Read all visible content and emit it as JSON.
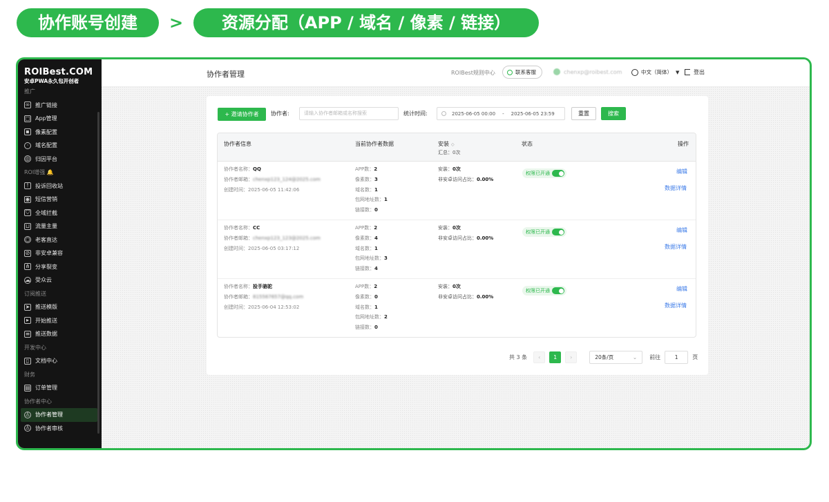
{
  "banner": {
    "step1": "协作账号创建",
    "arrow": ">",
    "step2": "资源分配（APP / 域名 / 像素 / 链接）"
  },
  "sidebar": {
    "logo_title": "ROIBest.COM",
    "logo_sub": "安卓PWA永久包开创者",
    "sections": [
      {
        "title": "推广",
        "items": [
          {
            "label": "推广链接",
            "icon": "link-icon"
          },
          {
            "label": "App管理",
            "icon": "app-icon"
          },
          {
            "label": "像素配置",
            "icon": "pixel-icon"
          },
          {
            "label": "域名配置",
            "icon": "globe-icon"
          },
          {
            "label": "归因平台",
            "icon": "attribution-icon"
          }
        ]
      },
      {
        "title": "ROI增强 🔔",
        "items": [
          {
            "label": "投诉回收站",
            "icon": "complaint-icon"
          },
          {
            "label": "短信营销",
            "icon": "sms-icon"
          },
          {
            "label": "全域拦截",
            "icon": "shield-icon"
          },
          {
            "label": "流量主量",
            "icon": "traffic-icon"
          },
          {
            "label": "老客直达",
            "icon": "customer-icon"
          },
          {
            "label": "非安卓兼容",
            "icon": "android-off-icon"
          },
          {
            "label": "分享裂变",
            "icon": "share-icon"
          },
          {
            "label": "受众云",
            "icon": "cloud-icon"
          }
        ]
      },
      {
        "title": "订阅推送",
        "items": [
          {
            "label": "推送模版",
            "icon": "send-icon"
          },
          {
            "label": "开始推送",
            "icon": "push-icon"
          },
          {
            "label": "推送数据",
            "icon": "data-icon"
          }
        ]
      },
      {
        "title": "开发中心",
        "items": [
          {
            "label": "文档中心",
            "icon": "doc-icon"
          }
        ]
      },
      {
        "title": "财务",
        "items": [
          {
            "label": "订单管理",
            "icon": "order-icon"
          }
        ]
      },
      {
        "title": "协作者中心",
        "items": [
          {
            "label": "协作者管理",
            "icon": "user-manage-icon",
            "active": true
          },
          {
            "label": "协作者审核",
            "icon": "user-review-icon"
          }
        ]
      }
    ]
  },
  "header": {
    "title": "协作者管理",
    "help": "ROIBest规则中心",
    "customer_service": "联系客服",
    "user_email": "chenxp@roibest.com",
    "language": "中文（简体）",
    "logout": "登出"
  },
  "filters": {
    "invite_button": "+ 邀请协作者",
    "collaborator_label": "协作者:",
    "collaborator_placeholder": "请输入协作者邮箱或名称搜索",
    "time_label": "统计时间:",
    "time_start": "2025-06-05 00:00",
    "time_sep": "-",
    "time_end": "2025-06-05 23:59",
    "reset": "重置",
    "search": "搜索"
  },
  "table": {
    "headers": {
      "info": "协作者信息",
      "data": "当前协作者数据",
      "install": "安装",
      "install_sort": "◇",
      "install_total": "汇总：0次",
      "status": "状态",
      "ops": "操作"
    },
    "labels": {
      "name": "协作者名称：",
      "email": "协作者邮箱：",
      "created": "创建时间：",
      "app": "APP数：",
      "pixel": "像素数：",
      "domain": "域名数：",
      "pkg": "包网地址数：",
      "link": "链接数：",
      "install": "安装：",
      "nonandroid": "非安卓访问占比：",
      "perm": "权限已开通",
      "edit": "编辑",
      "detail": "数据详情"
    },
    "rows": [
      {
        "name": "QQ",
        "email": "chenxp123_124@2025.com",
        "created": "2025-06-05 11:42:06",
        "app": "2",
        "pixel": "3",
        "domain": "1",
        "pkg": "1",
        "link": "0",
        "install": "0次",
        "nonandroid": "0.00%"
      },
      {
        "name": "CC",
        "email": "chenxp123_123@2025.com",
        "created": "2025-06-05 03:17:12",
        "app": "2",
        "pixel": "4",
        "domain": "1",
        "pkg": "3",
        "link": "4",
        "install": "0次",
        "nonandroid": "0.00%"
      },
      {
        "name": "投手骆驼",
        "email": "815567657@qq.com",
        "created": "2025-06-04 12:53:02",
        "app": "2",
        "pixel": "0",
        "domain": "1",
        "pkg": "2",
        "link": "0",
        "install": "0次",
        "nonandroid": "0.00%"
      }
    ]
  },
  "pager": {
    "total": "共 3 条",
    "prev": "‹",
    "current": "1",
    "next": "›",
    "page_size": "20条/页",
    "size_caret": "⌄",
    "goto": "前往",
    "goto_value": "1",
    "page": "页"
  },
  "colors": {
    "accent": "#2db84d",
    "link": "#3e7ce8",
    "sidebar_bg": "#141414"
  }
}
